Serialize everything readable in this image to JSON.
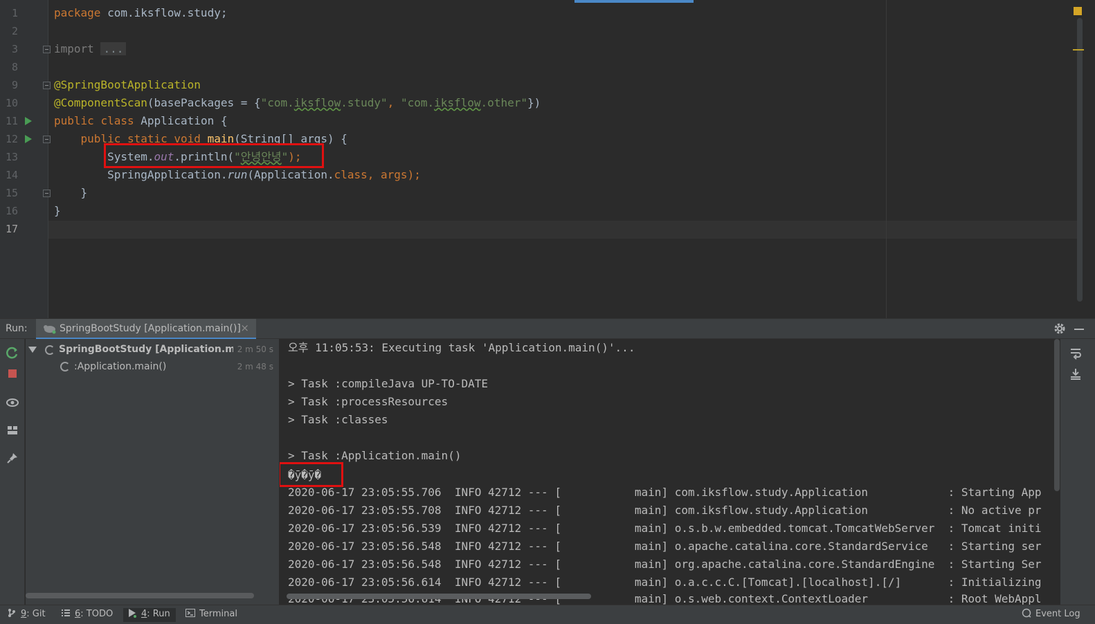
{
  "editor": {
    "line_numbers": [
      "1",
      "2",
      "3",
      "8",
      "9",
      "10",
      "11",
      "12",
      "13",
      "14",
      "15",
      "16",
      "17"
    ],
    "lines": {
      "l1": {
        "kw": "package",
        "text": " com.iksflow.study;"
      },
      "l3": {
        "kw": "import",
        "fold": "..."
      },
      "l9": {
        "ann": "@SpringBootApplication"
      },
      "l10": {
        "ann": "@ComponentScan",
        "open": "(basePackages = {",
        "s1a": "\"com.",
        "s1b": "iksflow",
        "s1c": ".study\"",
        "comma": ", ",
        "s2a": "\"com.",
        "s2b": "iksflow",
        "s2c": ".other\"",
        "close": "})"
      },
      "l11": {
        "kw1": "public",
        "kw2": "class",
        "name": "Application",
        "brace": "{"
      },
      "l12": {
        "kw1": "public",
        "kw2": "static",
        "kw3": "void",
        "meth": "main",
        "rest": "(String[] args) {"
      },
      "l13": {
        "a": "System.",
        "fld": "out",
        "b": ".println(",
        "str_q1": "\"",
        "str_body": "안녕안녕",
        "str_q2": "\"",
        "c": ");"
      },
      "l14": {
        "a": "SpringApplication.",
        "run": "run",
        "b": "(Application.",
        "kw": "class",
        "c": ", args);"
      },
      "l15": {
        "brace": "}"
      },
      "l16": {
        "brace": "}"
      }
    }
  },
  "run_panel": {
    "label": "Run:",
    "tab_title": "SpringBootStudy [Application.main()]",
    "tab_close": "×",
    "tree": [
      {
        "label": "SpringBootStudy [Application.main(",
        "time": "2 m 50 s"
      },
      {
        "label": ":Application.main()",
        "time": "2 m 48 s"
      }
    ]
  },
  "console": {
    "lines": [
      "오후 11:05:53: Executing task 'Application.main()'...",
      "",
      "> Task :compileJava UP-TO-DATE",
      "> Task :processResources",
      "> Task :classes",
      "",
      "> Task :Application.main()",
      "�ȳ�ȳ�",
      "2020-06-17 23:05:55.706  INFO 42712 --- [           main] com.iksflow.study.Application            : Starting App",
      "2020-06-17 23:05:55.708  INFO 42712 --- [           main] com.iksflow.study.Application            : No active pr",
      "2020-06-17 23:05:56.539  INFO 42712 --- [           main] o.s.b.w.embedded.tomcat.TomcatWebServer  : Tomcat initi",
      "2020-06-17 23:05:56.548  INFO 42712 --- [           main] o.apache.catalina.core.StandardService   : Starting ser",
      "2020-06-17 23:05:56.548  INFO 42712 --- [           main] org.apache.catalina.core.StandardEngine  : Starting Ser",
      "2020-06-17 23:05:56.614  INFO 42712 --- [           main] o.a.c.c.C.[Tomcat].[localhost].[/]       : Initializing",
      "2020-06-17 23:05:56.614  INFO 42712 --- [           main] o.s.web.context.ContextLoader            : Root WebAppl"
    ]
  },
  "bottom_tabs": [
    {
      "mnemonic": "9",
      "label": ": Git",
      "icon": "git-branch-icon"
    },
    {
      "mnemonic": "6",
      "label": ": TODO",
      "icon": "list-icon"
    },
    {
      "mnemonic": "4",
      "label": ": Run",
      "icon": "run-icon"
    },
    {
      "mnemonic": "",
      "label": "Terminal",
      "icon": "terminal-icon"
    }
  ],
  "event_log": "Event Log",
  "colors": {
    "keyword": "#cc7832",
    "annotation": "#bbb529",
    "string": "#6a8759",
    "highlight_box": "#e01010",
    "accent": "#4a88c7"
  }
}
